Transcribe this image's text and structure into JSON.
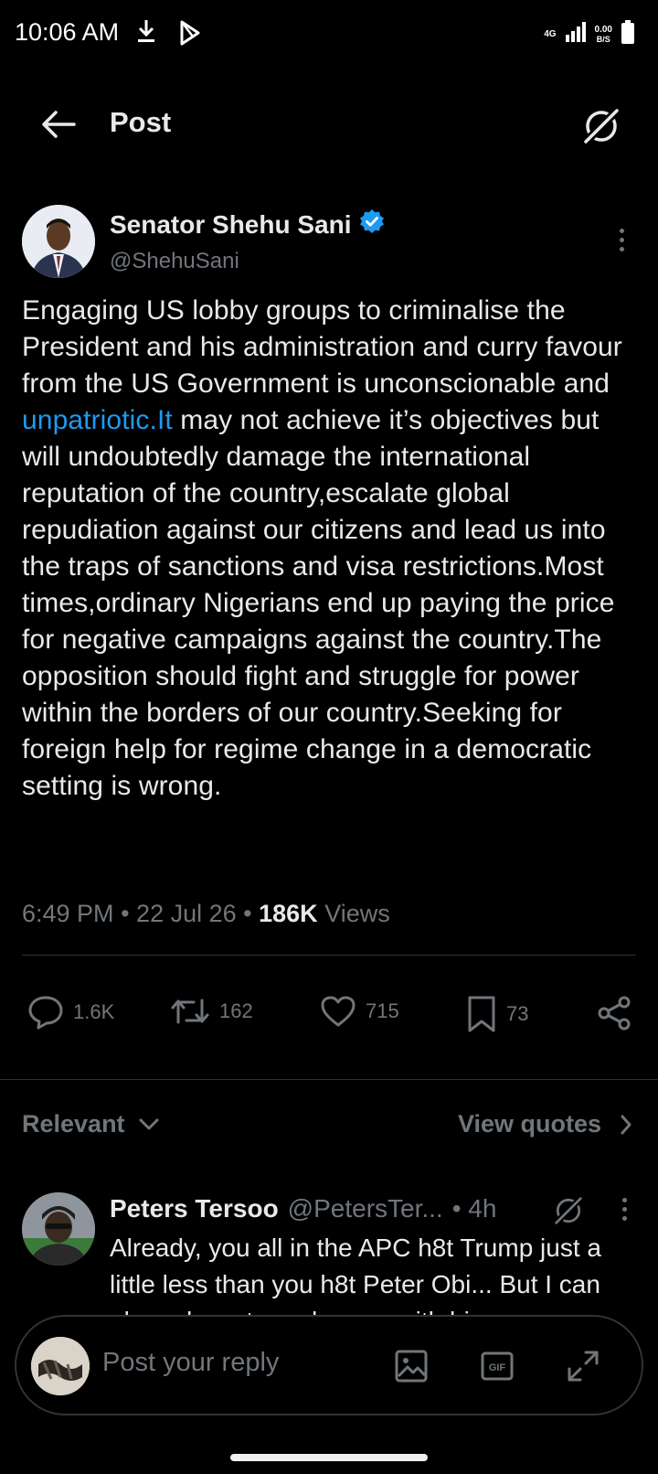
{
  "status_bar": {
    "time": "10:06 AM",
    "network": "4G",
    "speed_value": "0.00",
    "speed_unit": "B/S"
  },
  "header": {
    "title": "Post"
  },
  "post": {
    "author_name": "Senator Shehu Sani",
    "author_handle": "@ShehuSani",
    "text_before_link": "Engaging US lobby groups to criminalise the President and his administration and curry favour from the US Government is unconscionable and ",
    "link_text": "unpatriotic.It",
    "text_after_link": " may not achieve it’s objectives but will undoubtedly damage the international reputation of the country,escalate global repudiation against our citizens and lead us into the traps of sanctions and visa restrictions.Most times,ordinary Nigerians end up paying the price for negative campaigns against the country.The opposition should fight and struggle for power within the borders of our country.Seeking for foreign help for regime change in a democratic setting is wrong.",
    "time": "6:49 PM",
    "date": "22 Jul 26",
    "views_count": "186K",
    "views_label": "Views",
    "separator": "•"
  },
  "actions": {
    "replies": "1.6K",
    "reposts": "162",
    "likes": "715",
    "bookmarks": "73"
  },
  "filter": {
    "sort_label": "Relevant",
    "quotes_label": "View quotes"
  },
  "reply": {
    "name": "Peters Tersoo",
    "handle": "@PetersTer...",
    "age": "• 4h",
    "text": "Already, you all in the APC h8t Trump just a little less than you h8t Peter Obi... But I can also advocate and agree with him"
  },
  "composer": {
    "placeholder": "Post your reply"
  },
  "colors": {
    "background": "#000000",
    "text_primary": "#e7e9ea",
    "text_secondary": "#71767b",
    "link": "#1d9bf0",
    "verified": "#1d9bf0",
    "divider": "#2f3336"
  }
}
